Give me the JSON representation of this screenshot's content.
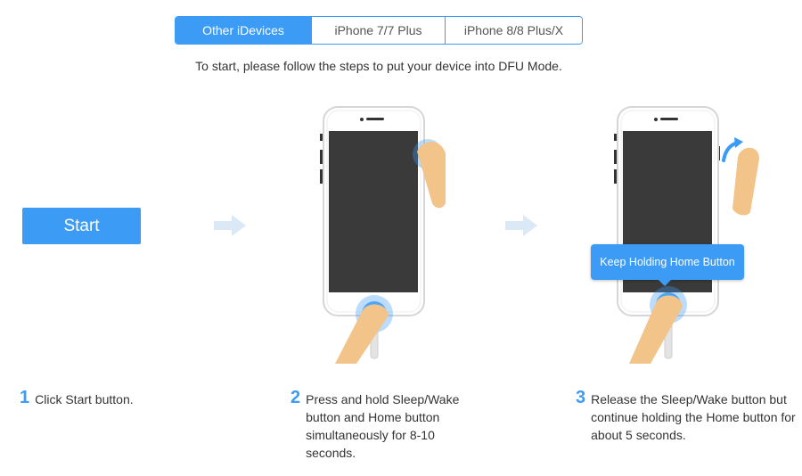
{
  "tabs": [
    {
      "label": "Other iDevices",
      "active": true
    },
    {
      "label": "iPhone 7/7 Plus",
      "active": false
    },
    {
      "label": "iPhone 8/8 Plus/X",
      "active": false
    }
  ],
  "instruction": "To start, please follow the steps to put your device into DFU Mode.",
  "start_button": {
    "label": "Start"
  },
  "tooltip": {
    "text": "Keep Holding Home Button"
  },
  "steps": [
    {
      "number": "1",
      "text": "Click Start button."
    },
    {
      "number": "2",
      "text": "Press and hold Sleep/Wake button and Home button simultaneously for 8-10 seconds."
    },
    {
      "number": "3",
      "text": "Release the Sleep/Wake button but continue holding the Home button for about 5 seconds."
    }
  ],
  "colors": {
    "accent": "#3b9bf5",
    "arrow": "#dbe8f5",
    "phone_screen": "#3a3a3a",
    "finger": "#f2c489"
  },
  "icons": [
    "arrow-right-icon",
    "iphone-icon",
    "finger-icon",
    "press-ripple-icon",
    "release-arrow-icon"
  ]
}
